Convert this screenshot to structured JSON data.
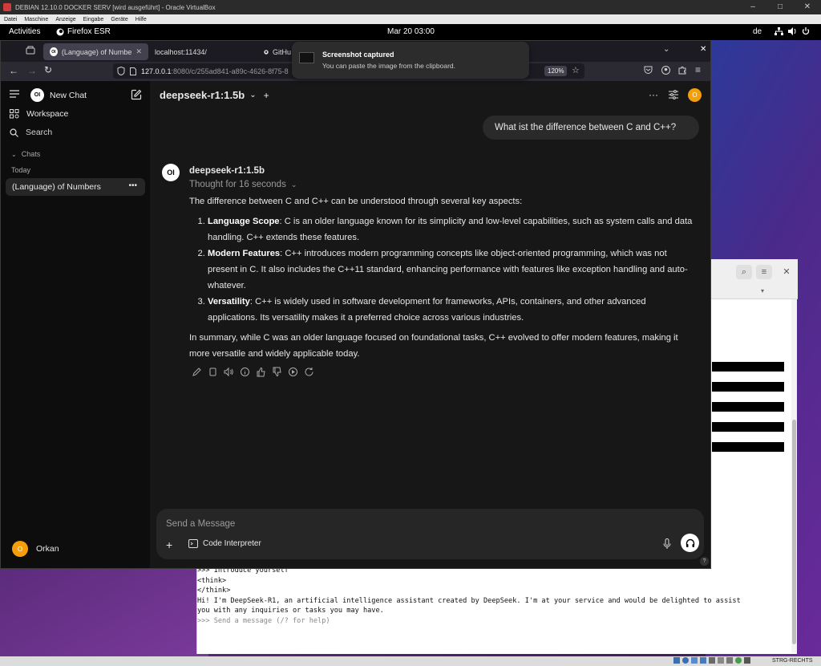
{
  "vbox": {
    "title": "DEBIAN 12.10.0 DOCKER SERV [wird ausgeführt] - Oracle VirtualBox",
    "menu": [
      "Datei",
      "Maschine",
      "Anzeige",
      "Eingabe",
      "Geräte",
      "Hilfe"
    ],
    "host_key": "STRG-RECHTS"
  },
  "gnome": {
    "activities": "Activities",
    "app_name": "Firefox ESR",
    "clock": "Mar 20  03:00",
    "lang": "de"
  },
  "firefox": {
    "tabs": [
      {
        "label": "(Language) of Numbers | O"
      },
      {
        "label": "localhost:11434/"
      },
      {
        "label": "GitHu"
      }
    ],
    "url_host": "127.0.0.1",
    "url_rest": ":8080/c/255ad841-a89c-4626-8f75-8",
    "zoom": "120%"
  },
  "toast": {
    "title": "Screenshot captured",
    "message": "You can paste the image from the clipboard."
  },
  "sidebar": {
    "new_chat": "New Chat",
    "workspace": "Workspace",
    "search": "Search",
    "chats_header": "Chats",
    "group_today": "Today",
    "chat_item": "(Language) of Numbers",
    "user_name": "Orkan",
    "user_initial": "O"
  },
  "main": {
    "model": "deepseek-r1:1.5b",
    "user_message": "What ist the difference between C and C++?",
    "assistant_name": "deepseek-r1:1.5b",
    "thought": "Thought for 16 seconds",
    "intro": "The difference between C and C++ can be understood through several key aspects:",
    "points": [
      {
        "title": "Language Scope",
        "text": ": C is an older language known for its simplicity and low-level capabilities, such as system calls and data handling. C++ extends these features."
      },
      {
        "title": "Modern Features",
        "text": ": C++ introduces modern programming concepts like object-oriented programming, which was not present in C. It also includes the C++11 standard, enhancing performance with features like exception handling and auto-whatever."
      },
      {
        "title": "Versatility",
        "text": ": C++ is widely used in software development for frameworks, APIs, containers, and other advanced applications. Its versatility makes it a preferred choice across various industries."
      }
    ],
    "summary": "In summary, while C was an older language focused on foundational tasks, C++ evolved to offer modern features, making it more versatile and widely applicable today.",
    "input_placeholder": "Send a Message",
    "code_interpreter": "Code Interpreter",
    "help": "?"
  },
  "terminal": {
    "lines": [
      ">>> Introduce yourself",
      "<think>",
      "",
      "</think>",
      "",
      "Hi! I'm DeepSeek-R1, an artificial intelligence assistant created by DeepSeek. I'm at your service and would be delighted to assist",
      "you with any inquiries or tasks you may have.",
      "",
      ">>> Send a message (/? for help)"
    ]
  }
}
